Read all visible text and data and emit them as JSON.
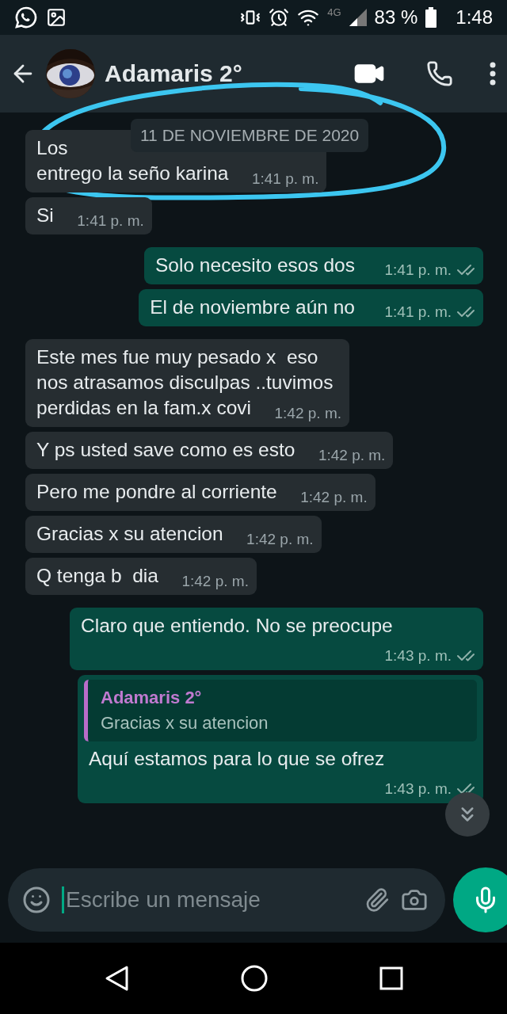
{
  "status_bar": {
    "network": "4G",
    "battery": "83 %",
    "time": "1:48"
  },
  "header": {
    "title": "Adamaris 2°"
  },
  "date_chip": "11 DE NOVIEMBRE DE 2020",
  "messages": [
    {
      "kind": "incoming",
      "lines": [
        "Los",
        "entrego la seño karina"
      ],
      "time": "1:41 p. m."
    },
    {
      "kind": "incoming",
      "lines": [
        "Si"
      ],
      "time": "1:41 p. m."
    },
    {
      "kind": "outgoing",
      "lines": [
        "Solo necesito esos dos"
      ],
      "time": "1:41 p. m.",
      "read": false
    },
    {
      "kind": "outgoing",
      "lines": [
        "El de noviembre aún no"
      ],
      "time": "1:41 p. m.",
      "read": false
    },
    {
      "kind": "incoming",
      "lines": [
        "Este mes fue muy pesado x  eso",
        "nos atrasamos disculpas ..tuvimos",
        "perdidas en la fam.x covi"
      ],
      "time": "1:42 p. m."
    },
    {
      "kind": "incoming",
      "lines": [
        "Y ps usted save como es esto"
      ],
      "time": "1:42 p. m."
    },
    {
      "kind": "incoming",
      "lines": [
        "Pero me pondre al corriente"
      ],
      "time": "1:42 p. m."
    },
    {
      "kind": "incoming",
      "lines": [
        "Gracias x su atencion"
      ],
      "time": "1:42 p. m."
    },
    {
      "kind": "incoming",
      "lines": [
        "Q tenga b  dia"
      ],
      "time": "1:42 p. m."
    },
    {
      "kind": "outgoing",
      "lines": [
        "Claro que entiendo. No se preocupe"
      ],
      "time": "1:43 p. m.",
      "read": false
    },
    {
      "kind": "outgoing",
      "quote": {
        "author": "Adamaris 2°",
        "text": "Gracias x su atencion"
      },
      "lines": [
        "Aquí estamos para lo que se ofrez"
      ],
      "time": "1:43 p. m.",
      "read": false
    }
  ],
  "composer": {
    "placeholder": "Escribe un mensaje"
  }
}
